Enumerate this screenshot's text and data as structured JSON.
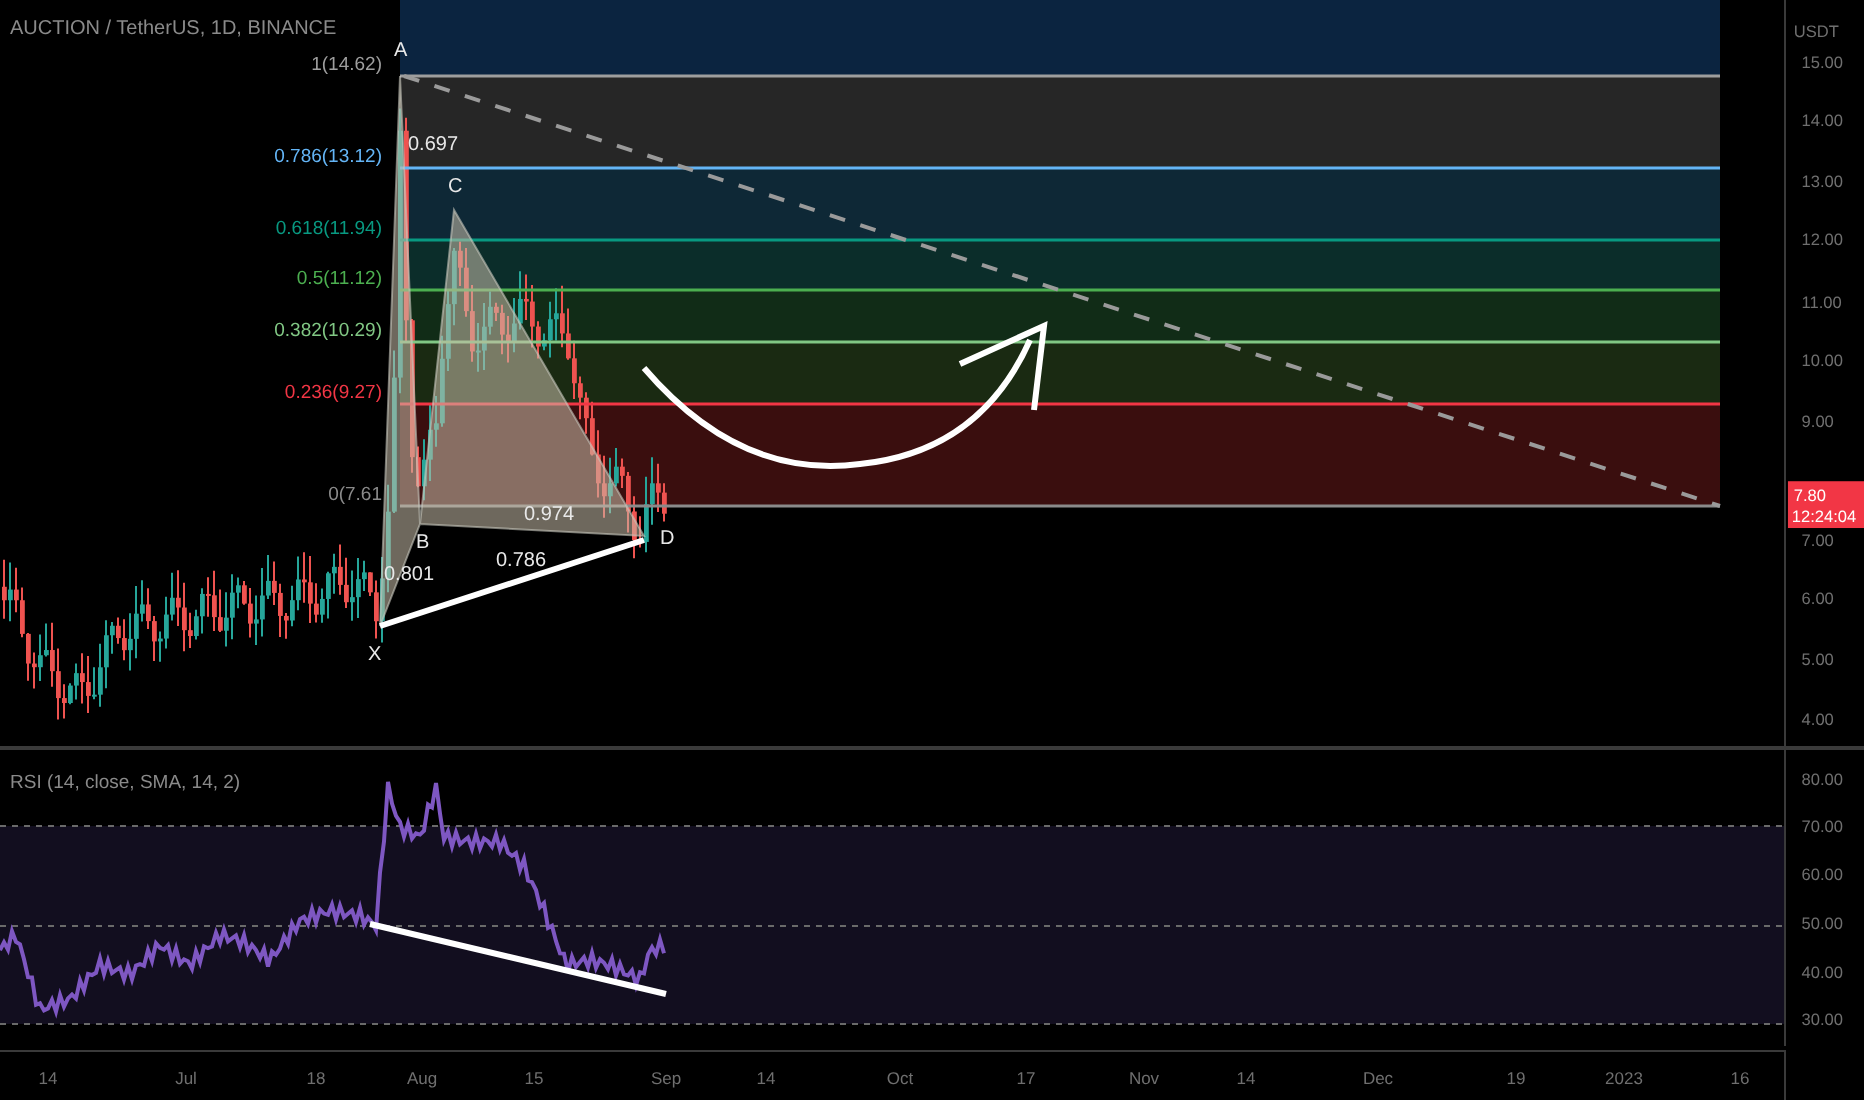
{
  "chart": {
    "title": "AUCTION / TetherUS, 1D, BINANCE",
    "price_axis": {
      "unit": "USDT",
      "labels": [
        "15.00",
        "14.00",
        "13.00",
        "12.00",
        "11.00",
        "10.00",
        "9.00",
        "7.00",
        "6.00",
        "5.00",
        "4.00"
      ]
    },
    "last_price": {
      "price": "7.80",
      "countdown": "12:24:04"
    },
    "fib_levels": [
      {
        "label": "1(14.62)",
        "color": "#9e9e9e"
      },
      {
        "label": "0.786(13.12)",
        "color": "#64b5f6"
      },
      {
        "label": "0.618(11.94)",
        "color": "#089981"
      },
      {
        "label": "0.5(11.12)",
        "color": "#4caf50"
      },
      {
        "label": "0.382(10.29)",
        "color": "#81c784"
      },
      {
        "label": "0.236(9.27)",
        "color": "#f23645"
      },
      {
        "label": "0(7.61",
        "color": "#8a8a8a"
      }
    ],
    "pattern_points": [
      "X",
      "A",
      "B",
      "C",
      "D"
    ],
    "pattern_ratios": [
      "0.697",
      "0.974",
      "0.801",
      "0.786"
    ]
  },
  "rsi": {
    "title": "RSI (14, close, SMA, 14, 2)",
    "axis_labels": [
      "80.00",
      "70.00",
      "60.00",
      "50.00",
      "40.00",
      "30.00"
    ]
  },
  "time_axis": [
    "14",
    "Jul",
    "18",
    "Aug",
    "15",
    "Sep",
    "14",
    "Oct",
    "17",
    "Nov",
    "14",
    "Dec",
    "19",
    "2023",
    "16"
  ]
}
